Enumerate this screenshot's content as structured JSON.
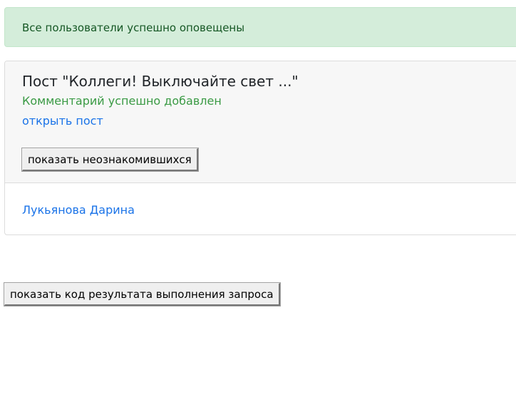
{
  "alert": {
    "text": "Все пользователи успешно оповещены"
  },
  "post": {
    "title": "Пост \"Коллеги! Выключайте свет ...\"",
    "comment_status": "Комментарий успешно добавлен",
    "open_link": "открыть пост",
    "show_unfamiliar_button": "показать неознакомившихся",
    "users": [
      "Лукьянова Дарина"
    ]
  },
  "footer": {
    "show_result_code_button": "показать код результата выполнения запроса"
  },
  "colors": {
    "alert_bg": "#d4edda",
    "alert_text": "#155724",
    "success_text": "#3a9a44",
    "link": "#1a73e8"
  }
}
